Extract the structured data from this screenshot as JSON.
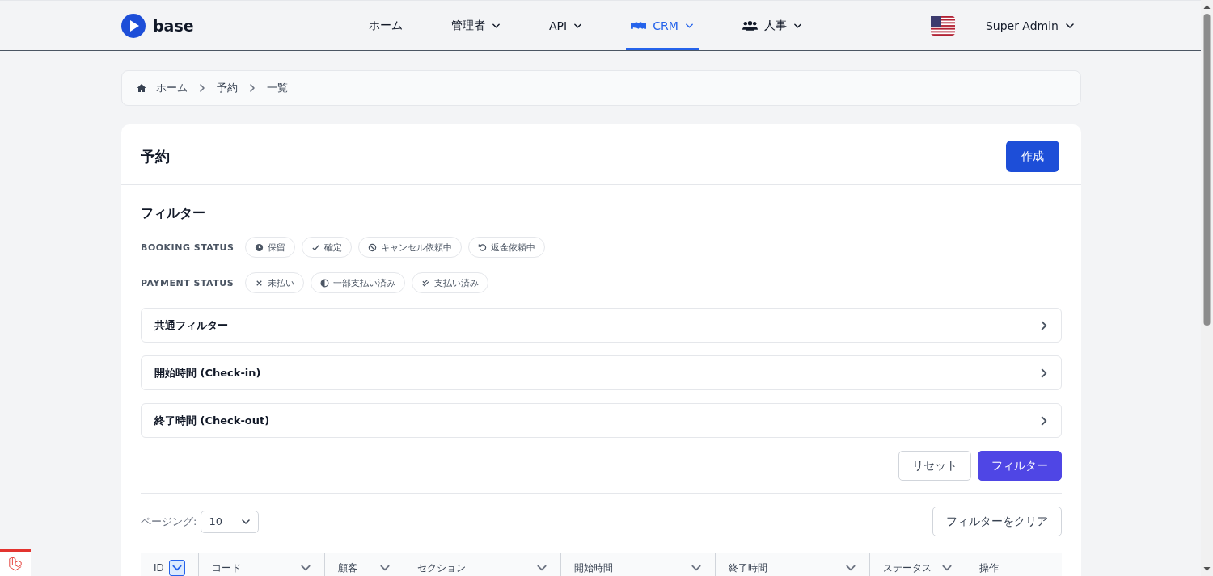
{
  "header": {
    "logo": "base",
    "nav": [
      {
        "label": "ホーム",
        "kind": "plain",
        "dropdown": false,
        "selected": false
      },
      {
        "label": "管理者",
        "kind": "plain",
        "dropdown": true,
        "selected": false
      },
      {
        "label": "API",
        "kind": "plain",
        "dropdown": true,
        "selected": false
      },
      {
        "label": "CRM",
        "kind": "handshake",
        "dropdown": true,
        "selected": true
      },
      {
        "label": "人事",
        "kind": "users",
        "dropdown": true,
        "selected": false
      }
    ],
    "user": "Super Admin"
  },
  "breadcrumb": [
    "ホーム",
    "予約",
    "一覧"
  ],
  "page": {
    "title": "予約",
    "create_button": "作成"
  },
  "filters": {
    "title": "フィルター",
    "groups": [
      {
        "label": "BOOKING STATUS",
        "chips": [
          {
            "label": "保留",
            "kind": "clock",
            "selected": false
          },
          {
            "label": "確定",
            "kind": "check",
            "selected": false
          },
          {
            "label": "キャンセル依頼中",
            "kind": "ban",
            "selected": false
          },
          {
            "label": "返金依頼中",
            "kind": "undo",
            "selected": false
          }
        ]
      },
      {
        "label": "PAYMENT STATUS",
        "chips": [
          {
            "label": "未払い",
            "kind": "x",
            "selected": false
          },
          {
            "label": "一部支払い済み",
            "kind": "half",
            "selected": false
          },
          {
            "label": "支払い済み",
            "kind": "double",
            "selected": false
          }
        ]
      }
    ],
    "sections": [
      {
        "label": "共通フィルター",
        "expanded": false
      },
      {
        "label": "開始時間 (Check-in)",
        "expanded": false
      },
      {
        "label": "終了時間 (Check-out)",
        "expanded": false
      }
    ],
    "reset_button": "リセット",
    "apply_button": "フィルター"
  },
  "table": {
    "paging_label": "ページング:",
    "paging_value": "10",
    "clear_button": "フィルターをクリア",
    "columns": [
      {
        "label": "ID",
        "kind": "toggle"
      },
      {
        "label": "コード",
        "kind": "menu"
      },
      {
        "label": "顧客",
        "kind": "menu"
      },
      {
        "label": "セクション",
        "kind": "menu"
      },
      {
        "label": "開始時間",
        "kind": "menu"
      },
      {
        "label": "終了時間",
        "kind": "menu"
      },
      {
        "label": "ステータス",
        "kind": "menu"
      },
      {
        "label": "操作",
        "kind": "plain"
      }
    ]
  }
}
